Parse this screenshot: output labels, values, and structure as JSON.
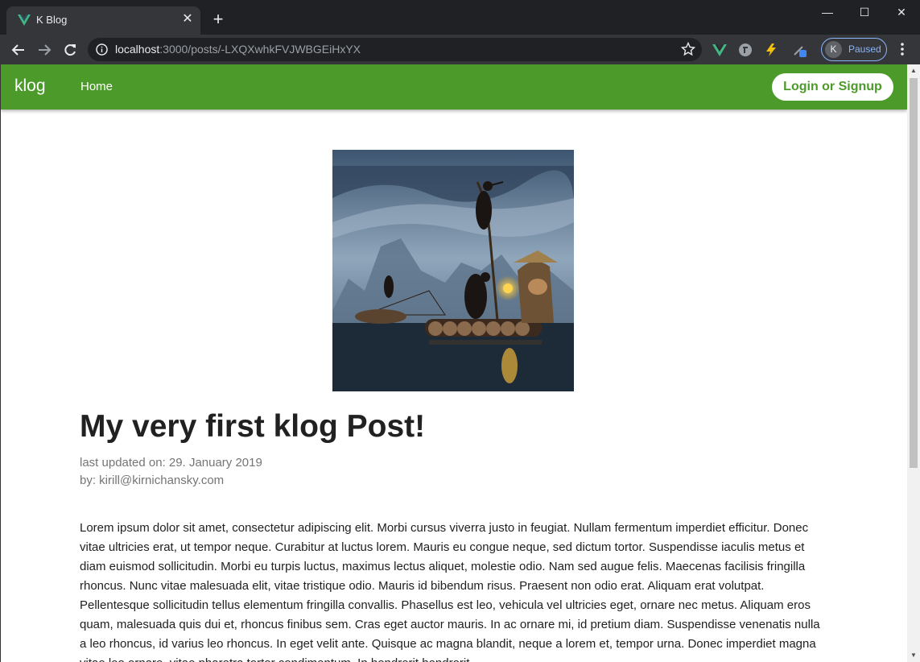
{
  "browser": {
    "tab_title": "K Blog",
    "tab_close": "✕",
    "new_tab": "+",
    "url_host": "localhost",
    "url_rest": ":3000/posts/-LXQXwhkFVJWBGEiHxYX",
    "profile_initial": "K",
    "profile_status": "Paused",
    "window_controls": {
      "minimize": "—",
      "maximize": "☐",
      "close": "✕"
    }
  },
  "appbar": {
    "brand": "klog",
    "nav_home": "Home",
    "login_button": "Login or Signup",
    "color": "#4c9a2a"
  },
  "post": {
    "title": "My very first klog Post!",
    "updated": "last updated on: 29. January 2019",
    "author": "by: kirill@kirnichansky.com",
    "body": "Lorem ipsum dolor sit amet, consectetur adipiscing elit. Morbi cursus viverra justo in feugiat. Nullam fermentum imperdiet efficitur. Donec vitae ultricies erat, ut tempor neque. Curabitur at luctus lorem. Mauris eu congue neque, sed dictum tortor. Suspendisse iaculis metus et diam euismod sollicitudin. Morbi eu turpis luctus, maximus lectus aliquet, molestie odio. Nam sed augue felis. Maecenas facilisis fringilla rhoncus. Nunc vitae malesuada elit, vitae tristique odio. Mauris id bibendum risus. Praesent non odio erat. Aliquam erat volutpat. Pellentesque sollicitudin tellus elementum fringilla convallis. Phasellus est leo, vehicula vel ultricies eget, ornare nec metus. Aliquam eros quam, malesuada quis dui et, rhoncus finibus sem. Cras eget auctor mauris. In ac ornare mi, id pretium diam. Suspendisse venenatis nulla a leo rhoncus, id varius leo rhoncus. In eget velit ante. Quisque ac magna blandit, neque a lorem et, tempor urna. Donec imperdiet magna vitae leo ornare, vitae pharetra tortor condimentum. In hendrerit hendrerit"
  }
}
